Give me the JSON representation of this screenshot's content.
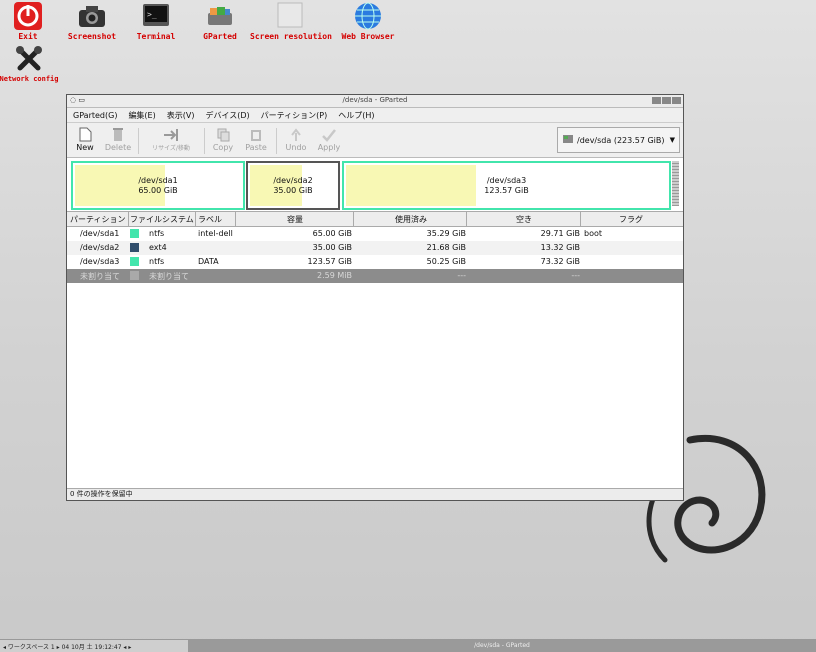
{
  "desktop": {
    "icons": [
      {
        "label": "Exit"
      },
      {
        "label": "Screenshot"
      },
      {
        "label": "Terminal"
      },
      {
        "label": "GParted"
      },
      {
        "label": "Screen resolution"
      },
      {
        "label": "Web Browser"
      },
      {
        "label": "Network config"
      }
    ]
  },
  "window": {
    "title": "/dev/sda - GParted",
    "menu": [
      "GParted(G)",
      "編集(E)",
      "表示(V)",
      "デバイス(D)",
      "パーティション(P)",
      "ヘルプ(H)"
    ],
    "toolbar": {
      "new": "New",
      "delete": "Delete",
      "resize": "リサイズ/移動",
      "copy": "Copy",
      "paste": "Paste",
      "undo": "Undo",
      "apply": "Apply"
    },
    "device": "/dev/sda  (223.57 GiB)",
    "graph": [
      {
        "name": "/dev/sda1",
        "size": "65.00 GiB"
      },
      {
        "name": "/dev/sda2",
        "size": "35.00 GiB"
      },
      {
        "name": "/dev/sda3",
        "size": "123.57 GiB"
      }
    ],
    "columns": [
      "パーティション",
      "ファイルシステム",
      "ラベル",
      "容量",
      "使用済み",
      "空き",
      "フラグ"
    ],
    "rows": [
      {
        "partition": "/dev/sda1",
        "fs": "ntfs",
        "label": "intel-dell",
        "size": "65.00 GiB",
        "used": "35.29 GiB",
        "free": "29.71 GiB",
        "flags": "boot",
        "color": "#42e5ac"
      },
      {
        "partition": "/dev/sda2",
        "fs": "ext4",
        "label": "",
        "size": "35.00 GiB",
        "used": "21.68 GiB",
        "free": "13.32 GiB",
        "flags": "",
        "color": "#314e6c"
      },
      {
        "partition": "/dev/sda3",
        "fs": "ntfs",
        "label": "DATA",
        "size": "123.57 GiB",
        "used": "50.25 GiB",
        "free": "73.32 GiB",
        "flags": "",
        "color": "#42e5ac"
      },
      {
        "partition": "未割り当て",
        "fs": "未割り当て",
        "label": "",
        "size": "2.59 MiB",
        "used": "---",
        "free": "---",
        "flags": "",
        "color": "#a9a9a9"
      }
    ],
    "status": "0 件の操作を保留中"
  },
  "taskbar": {
    "workspace": "◂ ワークスペース 1 ▸  04 10月 土 19:12:47  ◂ ▸",
    "task": "/dev/sda - GParted"
  }
}
